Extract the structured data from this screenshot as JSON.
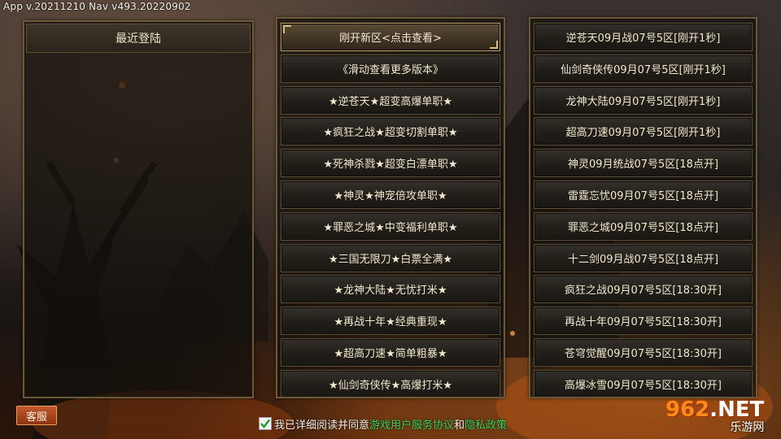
{
  "header": {
    "version_text": "App v.20211210  Nav v493.20220902"
  },
  "recent_panel": {
    "title": "最近登陆"
  },
  "middle_list": [
    {
      "label": "刚开新区<点击查看>",
      "selected": true
    },
    {
      "label": "《滑动查看更多版本》",
      "selected": false
    },
    {
      "label": "★逆苍天★超变高爆单职★",
      "selected": false
    },
    {
      "label": "★疯狂之战★超变切割单职★",
      "selected": false
    },
    {
      "label": "★死神杀戮★超变白漂单职★",
      "selected": false
    },
    {
      "label": "★神灵★神宠倍攻单职★",
      "selected": false
    },
    {
      "label": "★罪恶之城★中变福利单职★",
      "selected": false
    },
    {
      "label": "★三国无限刀★白票全满★",
      "selected": false
    },
    {
      "label": "★龙神大陆★无忧打米★",
      "selected": false
    },
    {
      "label": "★再战十年★经典重现★",
      "selected": false
    },
    {
      "label": "★超高刀速★简单粗暴★",
      "selected": false
    },
    {
      "label": "★仙剑奇侠传★高爆打米★",
      "selected": false
    }
  ],
  "right_list": [
    "逆苍天09月战07号5区[刚开1秒]",
    "仙剑奇侠传09月07号5区[刚开1秒]",
    "龙神大陆09月07号5区[刚开1秒]",
    "超高刀速09月07号5区[刚开1秒]",
    "神灵09月统战07号5区[18点开]",
    "雷霆忘忧09月07号5区[18点开]",
    "罪恶之城09月07号5区[18点开]",
    "十二剑09月战07号5区[18点开]",
    "疯狂之战09月07号5区[18:30开]",
    "再战十年09月07号5区[18:30开]",
    "苍穹觉醒09月07号5区[18:30开]",
    "高爆冰雪09月07号5区[18:30开]"
  ],
  "footer": {
    "kefu_label": "客服",
    "agree_checked": true,
    "agree_prefix": "我已详细阅读并同意",
    "terms_link": "游戏用户服务协议",
    "and_text": "和",
    "privacy_link": "隐私政策"
  },
  "watermark": {
    "top_left": "962",
    "top_right": ".NET",
    "bottom": "乐游网"
  },
  "colors": {
    "link": "#35d65a",
    "kefu": "#b04a1e",
    "gold_border": "#bfa16a"
  }
}
